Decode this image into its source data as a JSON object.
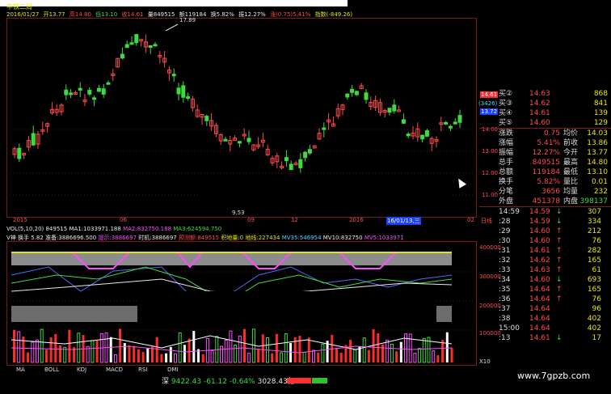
{
  "title": "中铁二局",
  "info": {
    "date": "2016/01/27",
    "open": "开13.77",
    "high": "高14.80",
    "low": "低13.10",
    "close": "收14.61",
    "volume": "量849515",
    "amount": "额119184",
    "turnover": "换5.82%",
    "amplitude": "振12.27%",
    "change": "涨(0.75)5.41%",
    "index": "指数(-849.26)"
  },
  "chart_labels": {
    "high_marker": "17.89",
    "low_marker": "9.53",
    "price_axis": [
      "14.00",
      "13.00",
      "12.00",
      "11.00"
    ],
    "price_marks": [
      "14.61",
      "(3426)",
      "13.72"
    ]
  },
  "date_axis": {
    "labels": [
      "2015",
      "06",
      "09",
      "12",
      "2016",
      "02"
    ],
    "cursor_date": "16/01/13,三",
    "period": "日线"
  },
  "volume_line": {
    "vol": "VOL(5,10,20) 849515",
    "ma1": "MA1:1033971.188",
    "ma2": "MA2:832750.188",
    "ma3": "MA3:624594.750"
  },
  "indicator_line": {
    "name": "V神",
    "turnover": "换手 5.82",
    "reserve": "准备:3886696.500",
    "hint": "提示:3886697",
    "timing": "时机:3886697",
    "forecast": "预测额:849515",
    "pile": "积地量:0",
    "floor": "地线:227434",
    "mv35": "MV35:546954",
    "mv10": "MV10:832750",
    "mv5": "MV5:1033971"
  },
  "indicator_axis": [
    "400000",
    "300000",
    "200000",
    "100000"
  ],
  "indicator_scale": "X10",
  "tabs": [
    "MA",
    "BOLL",
    "KDJ",
    "MACD",
    "RSI",
    "DMI"
  ],
  "status": {
    "market": "深",
    "index_value": "9422.43",
    "index_change": "-61.12",
    "index_pct": "-0.64%",
    "turnover": "3028.43亿"
  },
  "quote": {
    "bids": [
      {
        "label": "买②",
        "price": "14.63",
        "vol": "868"
      },
      {
        "label": "买③",
        "price": "14.62",
        "vol": "841"
      },
      {
        "label": "买④",
        "price": "14.61",
        "vol": "139"
      },
      {
        "label": "买⑤",
        "price": "14.60",
        "vol": "129"
      }
    ],
    "stats": [
      {
        "l1": "涨跌",
        "v1": "0.75",
        "l2": "均价",
        "v2": "14.03"
      },
      {
        "l1": "涨幅",
        "v1": "5.41%",
        "l2": "前收",
        "v2": "13.86"
      },
      {
        "l1": "振幅",
        "v1": "12.27%",
        "l2": "今开",
        "v2": "13.77"
      },
      {
        "l1": "总手",
        "v1": "849515",
        "l2": "最高",
        "v2": "14.80"
      },
      {
        "l1": "总额",
        "v1": "119184",
        "l2": "最低",
        "v2": "13.10"
      },
      {
        "l1": "换手",
        "v1": "5.82%",
        "l2": "量比",
        "v2": "0.01"
      },
      {
        "l1": "分笔",
        "v1": "3656",
        "l2": "均量",
        "v2": "232"
      },
      {
        "l1": "外盘",
        "v1": "451378",
        "l2": "内盘",
        "v2": "398137"
      }
    ],
    "ticks": [
      {
        "time": "14:59",
        "price": "14.59",
        "dir": "↓",
        "vol": "307"
      },
      {
        "time": ":28",
        "price": "14.59",
        "dir": "↓",
        "vol": "334"
      },
      {
        "time": ":29",
        "price": "14.60",
        "dir": "↑",
        "vol": "212"
      },
      {
        "time": ":30",
        "price": "14.60",
        "dir": "↑",
        "vol": "76"
      },
      {
        "time": ":31",
        "price": "14.61",
        "dir": "↑",
        "vol": "282"
      },
      {
        "time": ":32",
        "price": "14.62",
        "dir": "↑",
        "vol": "165"
      },
      {
        "time": ":33",
        "price": "14.63",
        "dir": "↑",
        "vol": "61"
      },
      {
        "time": ":34",
        "price": "14.60",
        "dir": "↓",
        "vol": "693"
      },
      {
        "time": ":35",
        "price": "14.64",
        "dir": "↑",
        "vol": "165"
      },
      {
        "time": ":36",
        "price": "14.64",
        "dir": "↑",
        "vol": "76"
      },
      {
        "time": ":37",
        "price": "14.64",
        "dir": "",
        "vol": "96"
      },
      {
        "time": ":38",
        "price": "14.64",
        "dir": "",
        "vol": "402"
      },
      {
        "time": "15:00",
        "price": "14.64",
        "dir": "",
        "vol": "402"
      },
      {
        "time": ":13",
        "price": "14.61",
        "dir": "↓",
        "vol": "17"
      }
    ]
  },
  "watermark": "www.7gpzb.com",
  "colors": {
    "up": "#ff4b4b",
    "down": "#3ddc3d",
    "text": "#e6e600",
    "grid": "#7a1b1b"
  }
}
